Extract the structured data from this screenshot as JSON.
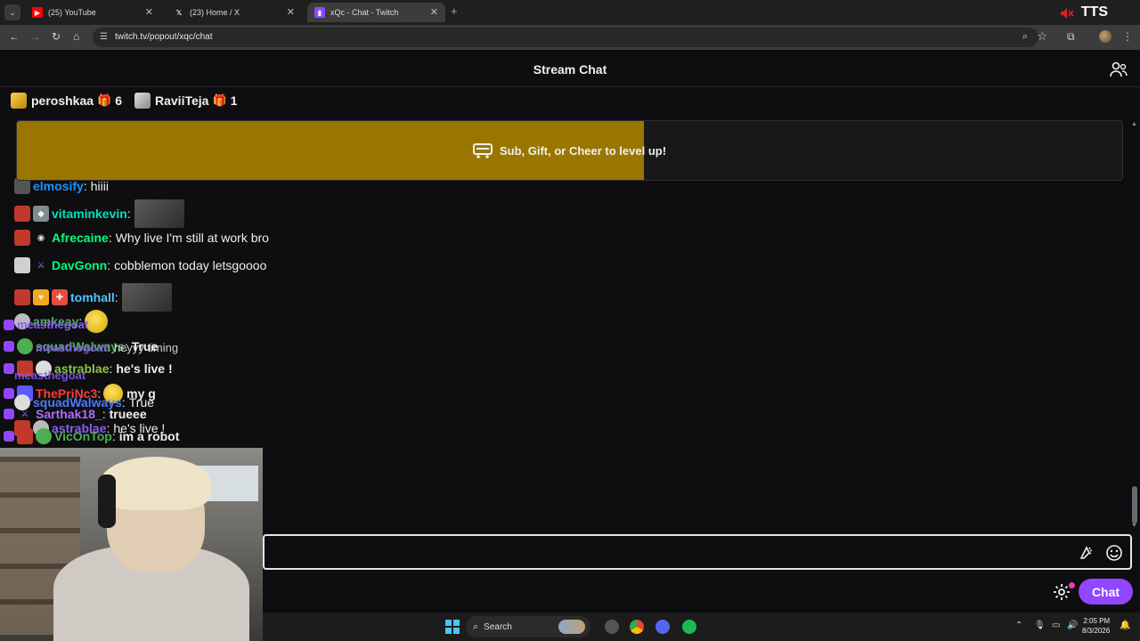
{
  "browser": {
    "tabs": [
      {
        "title": "(25) YouTube",
        "icon": "youtube-icon",
        "color": "#ff0000"
      },
      {
        "title": "(23) Home / X",
        "icon": "x-logo-icon",
        "color": "#ffffff"
      },
      {
        "title": "xQc - Chat - Twitch",
        "icon": "twitch-icon",
        "color": "#9147ff",
        "active": true
      }
    ],
    "new_tab": "+",
    "tab_close": "✕",
    "tts_label": "TTS",
    "url": "twitch.tv/popout/xqc/chat"
  },
  "chat": {
    "title": "Stream Chat",
    "gifters": [
      {
        "name": "peroshkaa",
        "count": "6"
      },
      {
        "name": "RaviiTeja",
        "count": "1"
      }
    ],
    "banner": {
      "text": "Sub, Gift, or Cheer to level up!",
      "progress": 0.567,
      "fill_color": "#9a7600"
    },
    "messages": [
      {
        "user": "elmosify",
        "color": "#1e90ff",
        "text": "hiiii"
      },
      {
        "user": "vitaminkevin",
        "color": "#00e0c0",
        "text": ""
      },
      {
        "user": "Afrecaine",
        "color": "#00ff7f",
        "text": "Why live I'm still at work bro"
      },
      {
        "user": "DavGonn",
        "color": "#00ff7f",
        "text": "cobblemon today letsgoooo"
      },
      {
        "user": "tomhall",
        "color": "#4bc5ff",
        "text": ""
      },
      {
        "user": "amkeay",
        "color": "#4caf50",
        "text": ""
      },
      {
        "user": "measthegoat",
        "color": "#8a5cf6",
        "text": ""
      },
      {
        "user": "squadWalways",
        "color": "#4caf50",
        "text": "True"
      },
      {
        "user": "measthegoat",
        "color": "#8a5cf6",
        "text": "heyyy timing"
      },
      {
        "user": "astrablae",
        "color": "#8bc34a",
        "text": "he's live !"
      },
      {
        "user": "measthegoat",
        "color": "#8a5cf6",
        "text": ""
      },
      {
        "user": "ThePriNc3",
        "color": "#ff3b3b",
        "text": "my g"
      },
      {
        "user": "squadWalways",
        "color": "#4a7bff",
        "text": "True"
      },
      {
        "user": "Sarthak18_",
        "color": "#b06cff",
        "text": "trueee"
      },
      {
        "user": "astrablae",
        "color": "#8a5cf6",
        "text": "he's live !"
      },
      {
        "user": "VicOnTop",
        "color": "#4caf50",
        "text": "im a robot"
      }
    ],
    "input": {
      "placeholder": "",
      "value": ""
    },
    "send_label": "Chat"
  },
  "taskbar": {
    "search_label": "Search",
    "time": "2:05 PM",
    "date": "8/3/2026"
  },
  "colors": {
    "twitch_purple": "#9147ff",
    "background": "#0e0e10"
  }
}
